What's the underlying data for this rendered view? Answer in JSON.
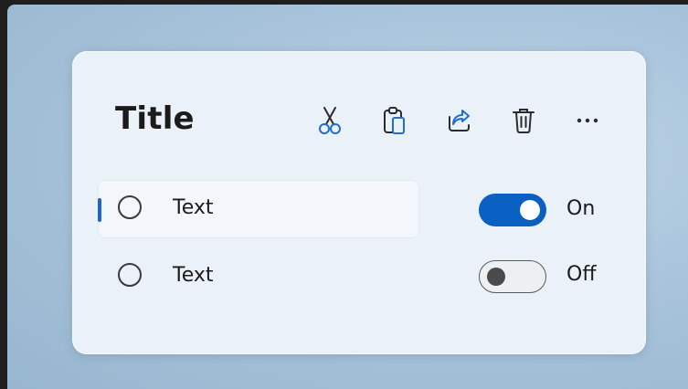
{
  "card": {
    "title": "Title",
    "toolbar": {
      "cut": "scissors-icon",
      "paste": "clipboard-icon",
      "share": "share-icon",
      "delete": "trash-icon",
      "more": "more-icon",
      "more_label": "..."
    },
    "items": [
      {
        "label": "Text",
        "selected": true,
        "toggle_state": "On"
      },
      {
        "label": "Text",
        "selected": false,
        "toggle_state": "Off"
      }
    ]
  },
  "colors": {
    "accent": "#0a5fc2",
    "indicator": "#1e63d6",
    "card_bg": "#ebf1f8",
    "desktop_bg": "#a9c4db"
  }
}
